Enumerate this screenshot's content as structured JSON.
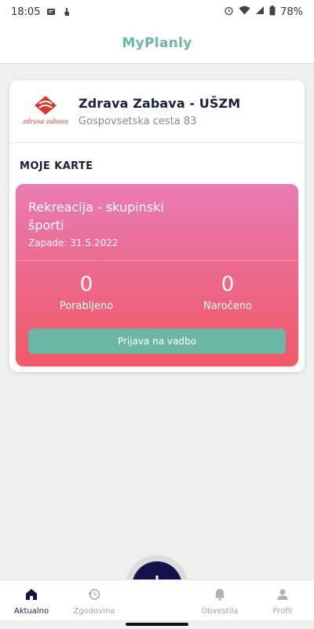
{
  "status_bar": {
    "time": "18:05",
    "battery": "78%"
  },
  "app": {
    "title": "MyPlanly"
  },
  "organization": {
    "name": "Zdrava Zabava - UŠZM",
    "address": "Gospovsetska cesta 83",
    "logo_text": "zdrava zabava",
    "logo_color": "#d63a2f"
  },
  "section": {
    "title": "MOJE KARTE"
  },
  "ticket": {
    "title": "Rekreacija - skupinski športi",
    "expiry": "Zapade: 31.5.2022",
    "used_value": "0",
    "used_label": "Porabljeno",
    "ordered_value": "0",
    "ordered_label": "Naročeno",
    "button_label": "Prijava na vadbo"
  },
  "bottom_nav": {
    "items": [
      {
        "label": "Aktualno",
        "icon": "home-icon",
        "active": true
      },
      {
        "label": "Zgodovina",
        "icon": "history-icon",
        "active": false
      },
      {
        "label": "Obvestila",
        "icon": "bell-icon",
        "active": false
      },
      {
        "label": "Profil",
        "icon": "user-icon",
        "active": false
      }
    ],
    "fab_icon": "plus-icon"
  },
  "colors": {
    "accent": "#6cb6a6",
    "navy": "#15124a",
    "ticket_gradient_top": "#e97db3",
    "ticket_gradient_bottom": "#f05a66"
  }
}
